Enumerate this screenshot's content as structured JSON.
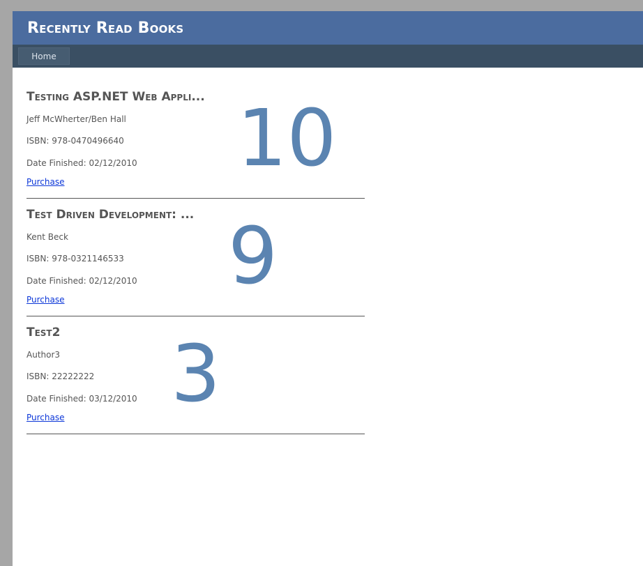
{
  "header": {
    "title": "Recently Read Books"
  },
  "nav": {
    "home_label": "Home"
  },
  "books": [
    {
      "title": "Testing ASP.NET Web Appli...",
      "author": "Jeff McWherter/Ben Hall",
      "isbn": "ISBN: 978-0470496640",
      "date_finished": "Date Finished: 02/12/2010",
      "purchase_label": "Purchase",
      "rating": "10"
    },
    {
      "title": "Test Driven Development: ...",
      "author": "Kent Beck",
      "isbn": "ISBN: 978-0321146533",
      "date_finished": "Date Finished: 02/12/2010",
      "purchase_label": "Purchase",
      "rating": "9"
    },
    {
      "title": "Test2",
      "author": "Author3",
      "isbn": "ISBN: 22222222",
      "date_finished": "Date Finished: 03/12/2010",
      "purchase_label": "Purchase",
      "rating": "3"
    }
  ],
  "colors": {
    "header_bg": "#4b6c9f",
    "nav_bg": "#3a4f63",
    "rating": "#5b84b1",
    "link": "#0b36d8"
  }
}
